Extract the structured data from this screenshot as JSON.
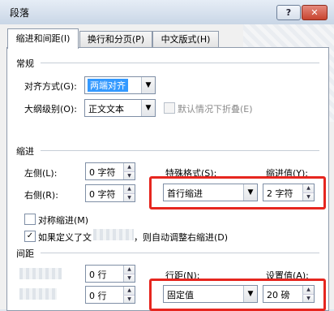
{
  "window": {
    "title": "段落",
    "help_label": "?",
    "close_label": "✕"
  },
  "tabs": [
    {
      "label": "缩进和间距(I)"
    },
    {
      "label": "换行和分页(P)"
    },
    {
      "label": "中文版式(H)"
    }
  ],
  "general": {
    "heading": "常规",
    "alignment_label": "对齐方式(G):",
    "alignment_value": "两端对齐",
    "outline_label": "大纲级别(O):",
    "outline_value": "正文文本",
    "collapse_label": "默认情况下折叠(E)"
  },
  "indent": {
    "heading": "缩进",
    "left_label": "左侧(L):",
    "left_value": "0 字符",
    "right_label": "右侧(R):",
    "right_value": "0 字符",
    "special_label": "特殊格式(S):",
    "special_value": "首行缩进",
    "indent_by_label": "缩进值(Y):",
    "indent_by_value": "2 字符",
    "mirror_label": "对称缩进(M)",
    "auto_adjust_label_a": "如果定义了文",
    "auto_adjust_label_b": "，则自动调整右缩进(D)",
    "auto_adjust_checked": true
  },
  "spacing": {
    "heading": "间距",
    "before_value": "0 行",
    "after_value": "0 行",
    "line_spacing_label": "行距(N):",
    "line_spacing_value": "固定值",
    "at_label": "设置值(A):",
    "at_value": "20 磅"
  },
  "glyphs": {
    "dropdown": "▼",
    "spin_up": "▲",
    "spin_down": "▼",
    "check": "✓"
  }
}
